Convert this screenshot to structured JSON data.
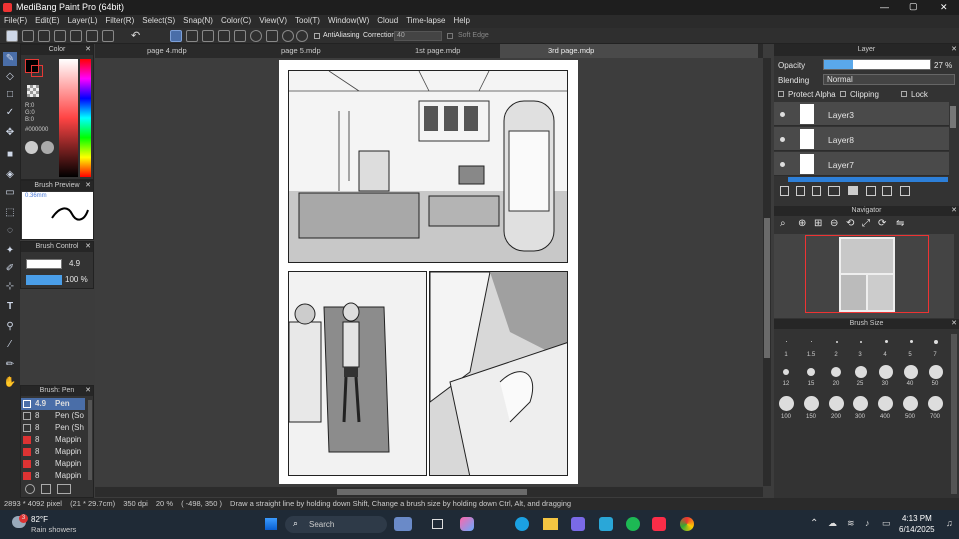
{
  "window": {
    "title": "MediBang Paint Pro (64bit)",
    "controls": [
      "—",
      "▢",
      "✕"
    ]
  },
  "menu": [
    "File(F)",
    "Edit(E)",
    "Layer(L)",
    "Filter(R)",
    "Select(S)",
    "Snap(N)",
    "Color(C)",
    "View(V)",
    "Tool(T)",
    "Window(W)",
    "Cloud",
    "Time-lapse",
    "Help"
  ],
  "toolbar": {
    "antialias_label": "AntiAliasing",
    "correction_label": "Correction",
    "correction_value": "40",
    "soft_edge_label": "Soft Edge"
  },
  "tabs": [
    "page 4.mdp",
    "page 5.mdp",
    "1st page.mdp",
    "3rd page.mdp"
  ],
  "color_panel": {
    "title": "Color",
    "r": "R:0",
    "g": "G:0",
    "b": "B:0",
    "hex": "#000000",
    "accent": "#e53935"
  },
  "brush_preview": {
    "title": "Brush Preview",
    "size": "0.36mm"
  },
  "brush_control": {
    "title": "Brush Control",
    "size_value": "4.9",
    "opacity_value": "100 %"
  },
  "brush_list": {
    "title": "Brush: Pen",
    "items": [
      {
        "size": "4.9",
        "name": "Pen"
      },
      {
        "size": "8",
        "name": "Pen (So"
      },
      {
        "size": "8",
        "name": "Pen (Sh"
      },
      {
        "size": "8",
        "name": "Mappin"
      },
      {
        "size": "8",
        "name": "Mappin"
      },
      {
        "size": "8",
        "name": "Mappin"
      },
      {
        "size": "8",
        "name": "Mappin"
      }
    ]
  },
  "layer_panel": {
    "title": "Layer",
    "opacity_label": "Opacity",
    "opacity_value": "27 %",
    "opacity_level": 0.27,
    "blending_label": "Blending",
    "blending_value": "Normal",
    "protect_alpha": "Protect Alpha",
    "clipping": "Clipping",
    "lock": "Lock",
    "layers": [
      "Layer3",
      "Layer8",
      "Layer7"
    ]
  },
  "navigator": {
    "title": "Navigator"
  },
  "brush_size": {
    "title": "Brush Size",
    "row1": [
      "1",
      "1.5",
      "2",
      "3",
      "4",
      "5",
      "7"
    ],
    "row2": [
      "12",
      "15",
      "20",
      "25",
      "30",
      "40",
      "50"
    ],
    "row3": [
      "100",
      "150",
      "200",
      "300",
      "400",
      "500",
      "700"
    ]
  },
  "status": {
    "size": "2893 * 4092 pixel",
    "print": "(21 * 29.7cm)",
    "dpi": "350 dpi",
    "zoom": "20 %",
    "coords": "( -498, 350 )",
    "hint": "Draw a straight line by holding down Shift, Change a brush size by holding down Ctrl, Alt, and dragging"
  },
  "taskbar": {
    "weather_temp": "82°F",
    "weather_desc": "Rain showers",
    "notif": "3",
    "search": "Search",
    "time": "4:13 PM",
    "date": "6/14/2025"
  }
}
